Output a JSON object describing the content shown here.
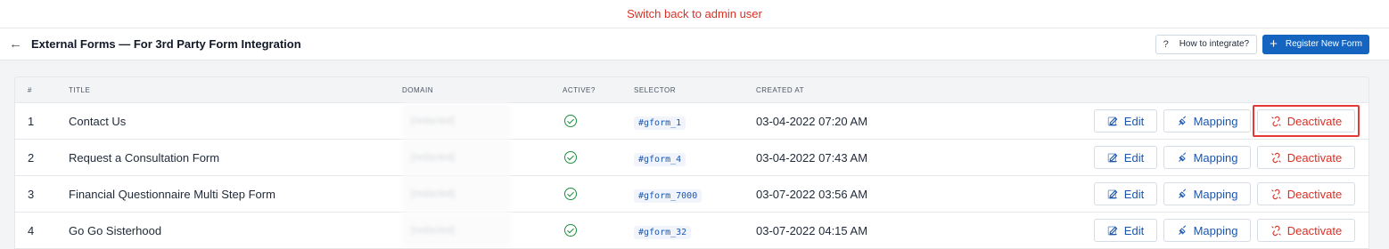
{
  "banner": {
    "text": "Switch back to admin user"
  },
  "header": {
    "back_icon": "arrow-left-icon",
    "title": "External Forms — For 3rd Party Form Integration",
    "help_label": "How to integrate?",
    "help_icon": "question-icon",
    "register_label": "Register New Form",
    "register_icon": "plus-icon"
  },
  "table": {
    "headers": {
      "num": "#",
      "title": "TITLE",
      "domain": "DOMAIN",
      "active": "ACTIVE?",
      "selector": "SELECTOR",
      "created": "CREATED AT"
    },
    "rows": [
      {
        "num": "1",
        "title": "Contact Us",
        "domain": "[redacted]",
        "active": true,
        "selector": "#gform_1",
        "created": "03-04-2022 07:20 AM"
      },
      {
        "num": "2",
        "title": "Request a Consultation Form",
        "domain": "[redacted]",
        "active": true,
        "selector": "#gform_4",
        "created": "03-04-2022 07:43 AM"
      },
      {
        "num": "3",
        "title": "Financial Questionnaire Multi Step Form",
        "domain": "[redacted]",
        "active": true,
        "selector": "#gform_7000",
        "created": "03-07-2022 03:56 AM"
      },
      {
        "num": "4",
        "title": "Go Go Sisterhood",
        "domain": "[redacted]",
        "active": true,
        "selector": "#gform_32",
        "created": "03-07-2022 04:15 AM"
      }
    ],
    "actions": {
      "edit_label": "Edit",
      "mapping_label": "Mapping",
      "deactivate_label": "Deactivate"
    }
  },
  "colors": {
    "primary": "#1565c0",
    "danger": "#d93025",
    "success": "#1e8e3e",
    "highlight": "#e53935"
  }
}
